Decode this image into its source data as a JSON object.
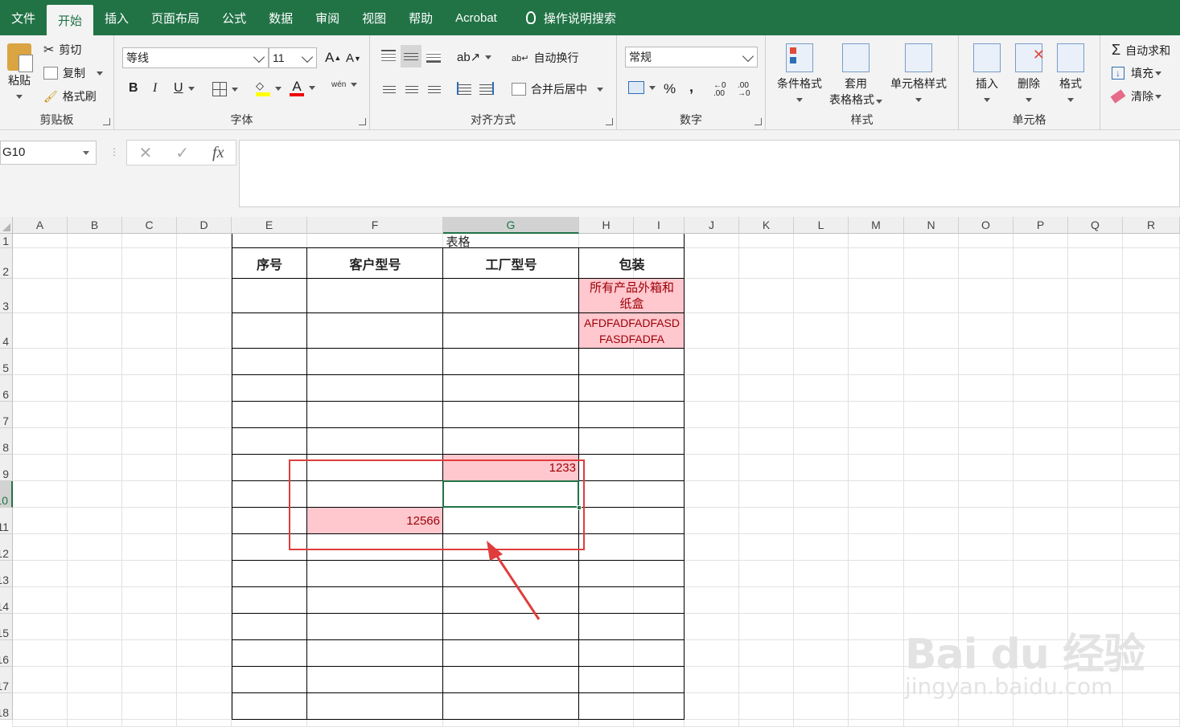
{
  "menu": {
    "tabs": [
      "文件",
      "开始",
      "插入",
      "页面布局",
      "公式",
      "数据",
      "审阅",
      "视图",
      "帮助",
      "Acrobat"
    ],
    "active": "开始",
    "search": "操作说明搜索"
  },
  "ribbon": {
    "clipboard": {
      "label": "剪贴板",
      "paste": "粘贴",
      "cut": "剪切",
      "copy": "复制",
      "format_painter": "格式刷"
    },
    "font": {
      "label": "字体",
      "name": "等线",
      "size": "11",
      "bold": "B",
      "italic": "I",
      "underline": "U",
      "grow": "A",
      "shrink": "A",
      "phonetic": "wén"
    },
    "alignment": {
      "label": "对齐方式",
      "wrap": "自动换行",
      "merge": "合并后居中"
    },
    "number": {
      "label": "数字",
      "format": "常规",
      "percent": "%",
      "comma": ",",
      "inc_decimal": "←0 .00",
      "dec_decimal": ".00 →0"
    },
    "styles": {
      "label": "样式",
      "conditional": "条件格式",
      "table_format": "套用",
      "table_format2": "表格格式",
      "cell_styles": "单元格样式"
    },
    "cells": {
      "label": "单元格",
      "insert": "插入",
      "delete": "删除",
      "format": "格式"
    },
    "editing": {
      "autosum": "自动求和",
      "fill": "填充",
      "clear": "清除"
    }
  },
  "formula_bar": {
    "name_box": "G10",
    "cancel": "✕",
    "enter": "✓",
    "fx": "fx",
    "content": ""
  },
  "columns": [
    "A",
    "B",
    "C",
    "D",
    "E",
    "F",
    "G",
    "H",
    "I",
    "J",
    "K",
    "L",
    "M",
    "N",
    "O",
    "P",
    "Q",
    "R"
  ],
  "selected_column": "G",
  "rows": [
    "1",
    "2",
    "3",
    "4",
    "5",
    "6",
    "7",
    "8",
    "9",
    "10",
    "11",
    "12",
    "13",
    "14",
    "15",
    "16",
    "17",
    "18"
  ],
  "selected_row": "10",
  "table": {
    "title": "表格",
    "headers": [
      "序号",
      "客户型号",
      "工厂型号",
      "包装"
    ],
    "h3": "所有产品外箱和纸盒",
    "h4": "AFDFADFADFASDFASDFADFA",
    "g9": "1233",
    "f11": "12566"
  },
  "colors": {
    "accent": "#217346",
    "highlight_fill": "#ffc7ce",
    "highlight_text": "#9c0006",
    "annotation": "#e03c3c"
  },
  "watermark": {
    "brand": "Bai du 经验",
    "url": "jingyan.baidu.com"
  }
}
